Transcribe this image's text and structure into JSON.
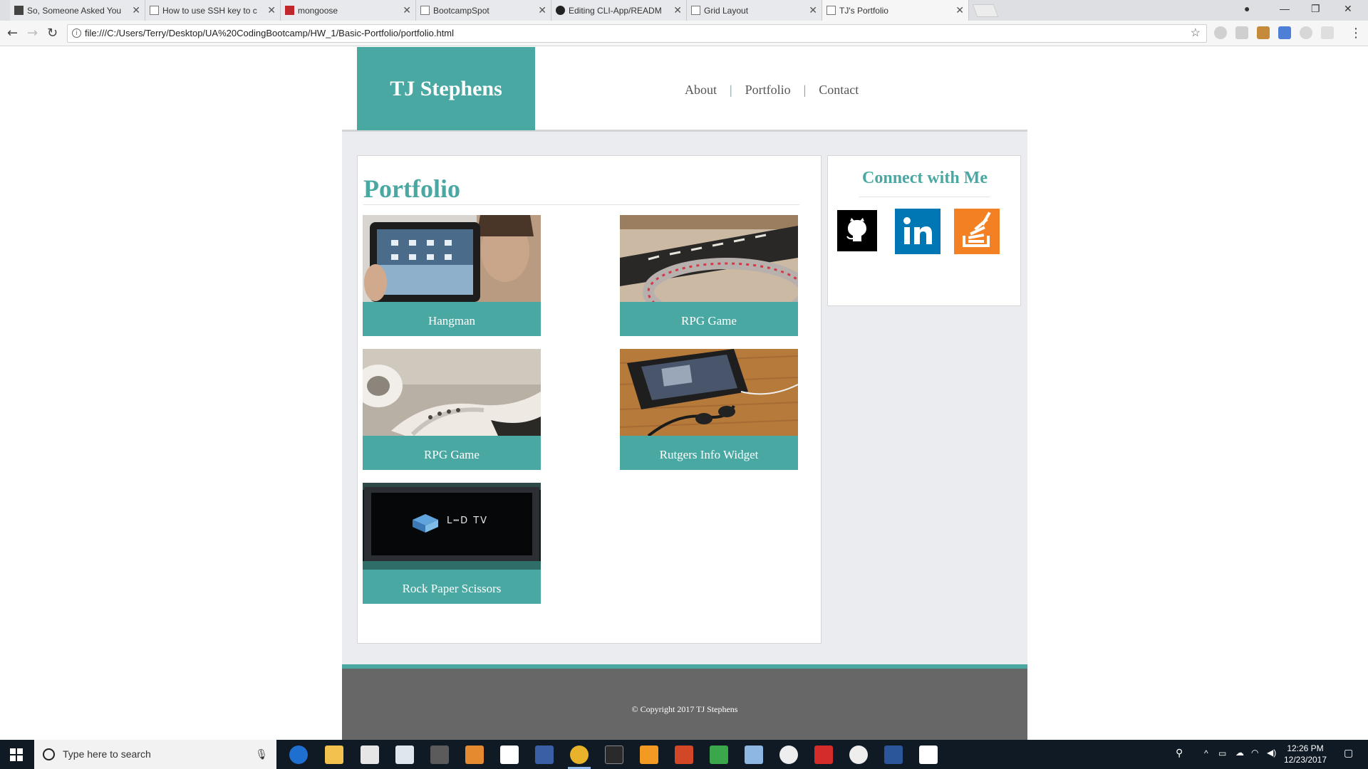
{
  "browser": {
    "tabs": [
      {
        "title": "So, Someone Asked You",
        "active": false
      },
      {
        "title": "How to use SSH key to c",
        "active": false
      },
      {
        "title": "mongoose",
        "active": false
      },
      {
        "title": "BootcampSpot",
        "active": false
      },
      {
        "title": "Editing CLI-App/READM",
        "active": false
      },
      {
        "title": "Grid Layout",
        "active": false
      },
      {
        "title": "TJ's Portfolio",
        "active": true
      }
    ],
    "url": "file:///C:/Users/Terry/Desktop/UA%20CodingBootcamp/HW_1/Basic-Portfolio/portfolio.html"
  },
  "site": {
    "brand": "TJ Stephens",
    "nav": [
      "About",
      "Portfolio",
      "Contact"
    ],
    "nav_separator": "|",
    "portfolio_heading": "Portfolio",
    "items": [
      {
        "caption": "Hangman",
        "image": "tablet-photo"
      },
      {
        "caption": "RPG Game",
        "image": "keyboard-photo"
      },
      {
        "caption": "RPG Game",
        "image": "earbuds-photo"
      },
      {
        "caption": "Rutgers Info Widget",
        "image": "phone-headphones-photo"
      },
      {
        "caption": "Rock Paper Scissors",
        "image": "led-tv-photo"
      }
    ],
    "connect_heading": "Connect with Me",
    "social": [
      {
        "name": "github",
        "color": "#000000"
      },
      {
        "name": "linkedin",
        "color": "#0077b5"
      },
      {
        "name": "stackoverflow",
        "color": "#f48024"
      }
    ],
    "footer": "© Copyright 2017 TJ Stephens",
    "accent_color": "#4aa8a3"
  },
  "taskbar": {
    "search_placeholder": "Type here to search",
    "time": "12:26 PM",
    "date": "12/23/2017"
  }
}
